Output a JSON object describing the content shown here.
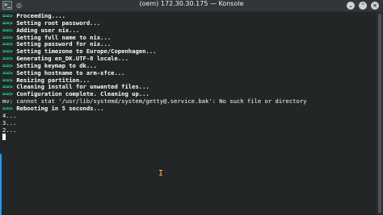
{
  "window": {
    "title": "(oem) 172.30.30.175 — Konsole",
    "app_icon": "terminal-icon",
    "pin_icon": "pin-icon",
    "buttons": {
      "minimize": "minimize-icon",
      "maximize": "maximize-icon",
      "close": "close-icon"
    }
  },
  "terminal": {
    "lines": [
      {
        "prefix": "==>",
        "text": "Proceeding...."
      },
      {
        "prefix": "==>",
        "text": "Setting root password..."
      },
      {
        "prefix": "==>",
        "text": "Adding user nix..."
      },
      {
        "prefix": "==>",
        "text": "Setting full name to nix..."
      },
      {
        "prefix": "==>",
        "text": "Setting password for nix..."
      },
      {
        "prefix": "==>",
        "text": "Setting timezone to Europe/Copenhagen..."
      },
      {
        "prefix": "==>",
        "text": "Generating en_DK.UTF-8 locale..."
      },
      {
        "prefix": "==>",
        "text": "Setting keymap to dk..."
      },
      {
        "prefix": "==>",
        "text": "Setting hostname to arm-xfce..."
      },
      {
        "prefix": "==>",
        "text": "Resizing partition..."
      },
      {
        "prefix": "==>",
        "text": "Cleaning install for unwanted files..."
      },
      {
        "prefix": "==>",
        "text": "Configuration complete. Cleaning up..."
      },
      {
        "prefix": "",
        "text": "mv: cannot stat '/usr/lib/systemd/system/getty@.service.bak': No such file or directory"
      },
      {
        "prefix": "==>",
        "text": "Rebooting in 5 seconds..."
      },
      {
        "prefix": "",
        "text": "4..."
      },
      {
        "prefix": "",
        "text": "3..."
      },
      {
        "prefix": "",
        "text": "2..."
      }
    ]
  },
  "colors": {
    "prompt": "#1cdc9a",
    "text": "#fcfcfc",
    "background": "#232627",
    "titlebar": "#31363b",
    "mouse_ibeam": "#fdbc4b"
  },
  "mouse_cursor": "text-ibeam-icon"
}
